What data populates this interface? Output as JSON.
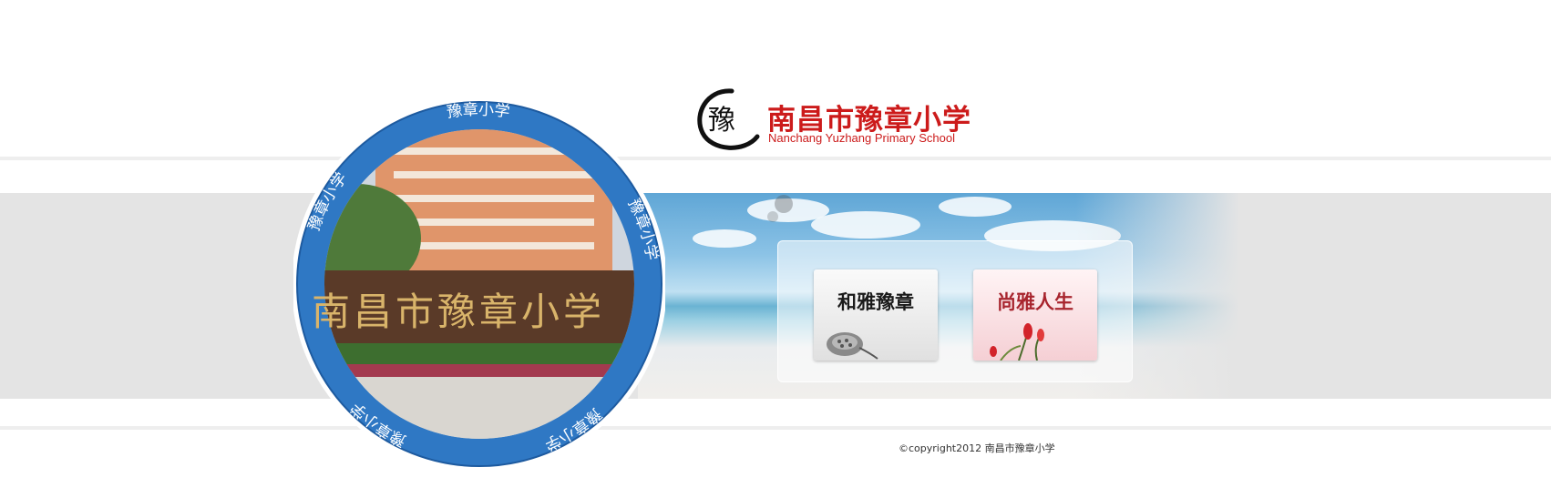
{
  "logo": {
    "title_cn": "南昌市豫章小学",
    "title_en": "Nanchang Yuzhang Primary School",
    "mark_char": "豫"
  },
  "emblem": {
    "ring_text": "豫章小学",
    "sign_text": "南昌市豫章小学",
    "ring_color": "#2f78c4"
  },
  "links": [
    {
      "label": "和雅豫章",
      "icon": "lotus-seedpod-icon"
    },
    {
      "label": "尚雅人生",
      "icon": "flower-icon"
    }
  ],
  "footer": {
    "copyright": "©copyright2012 南昌市豫章小学"
  },
  "colors": {
    "brand_red": "#cc1b1b",
    "band_gray": "#e4e4e4"
  }
}
